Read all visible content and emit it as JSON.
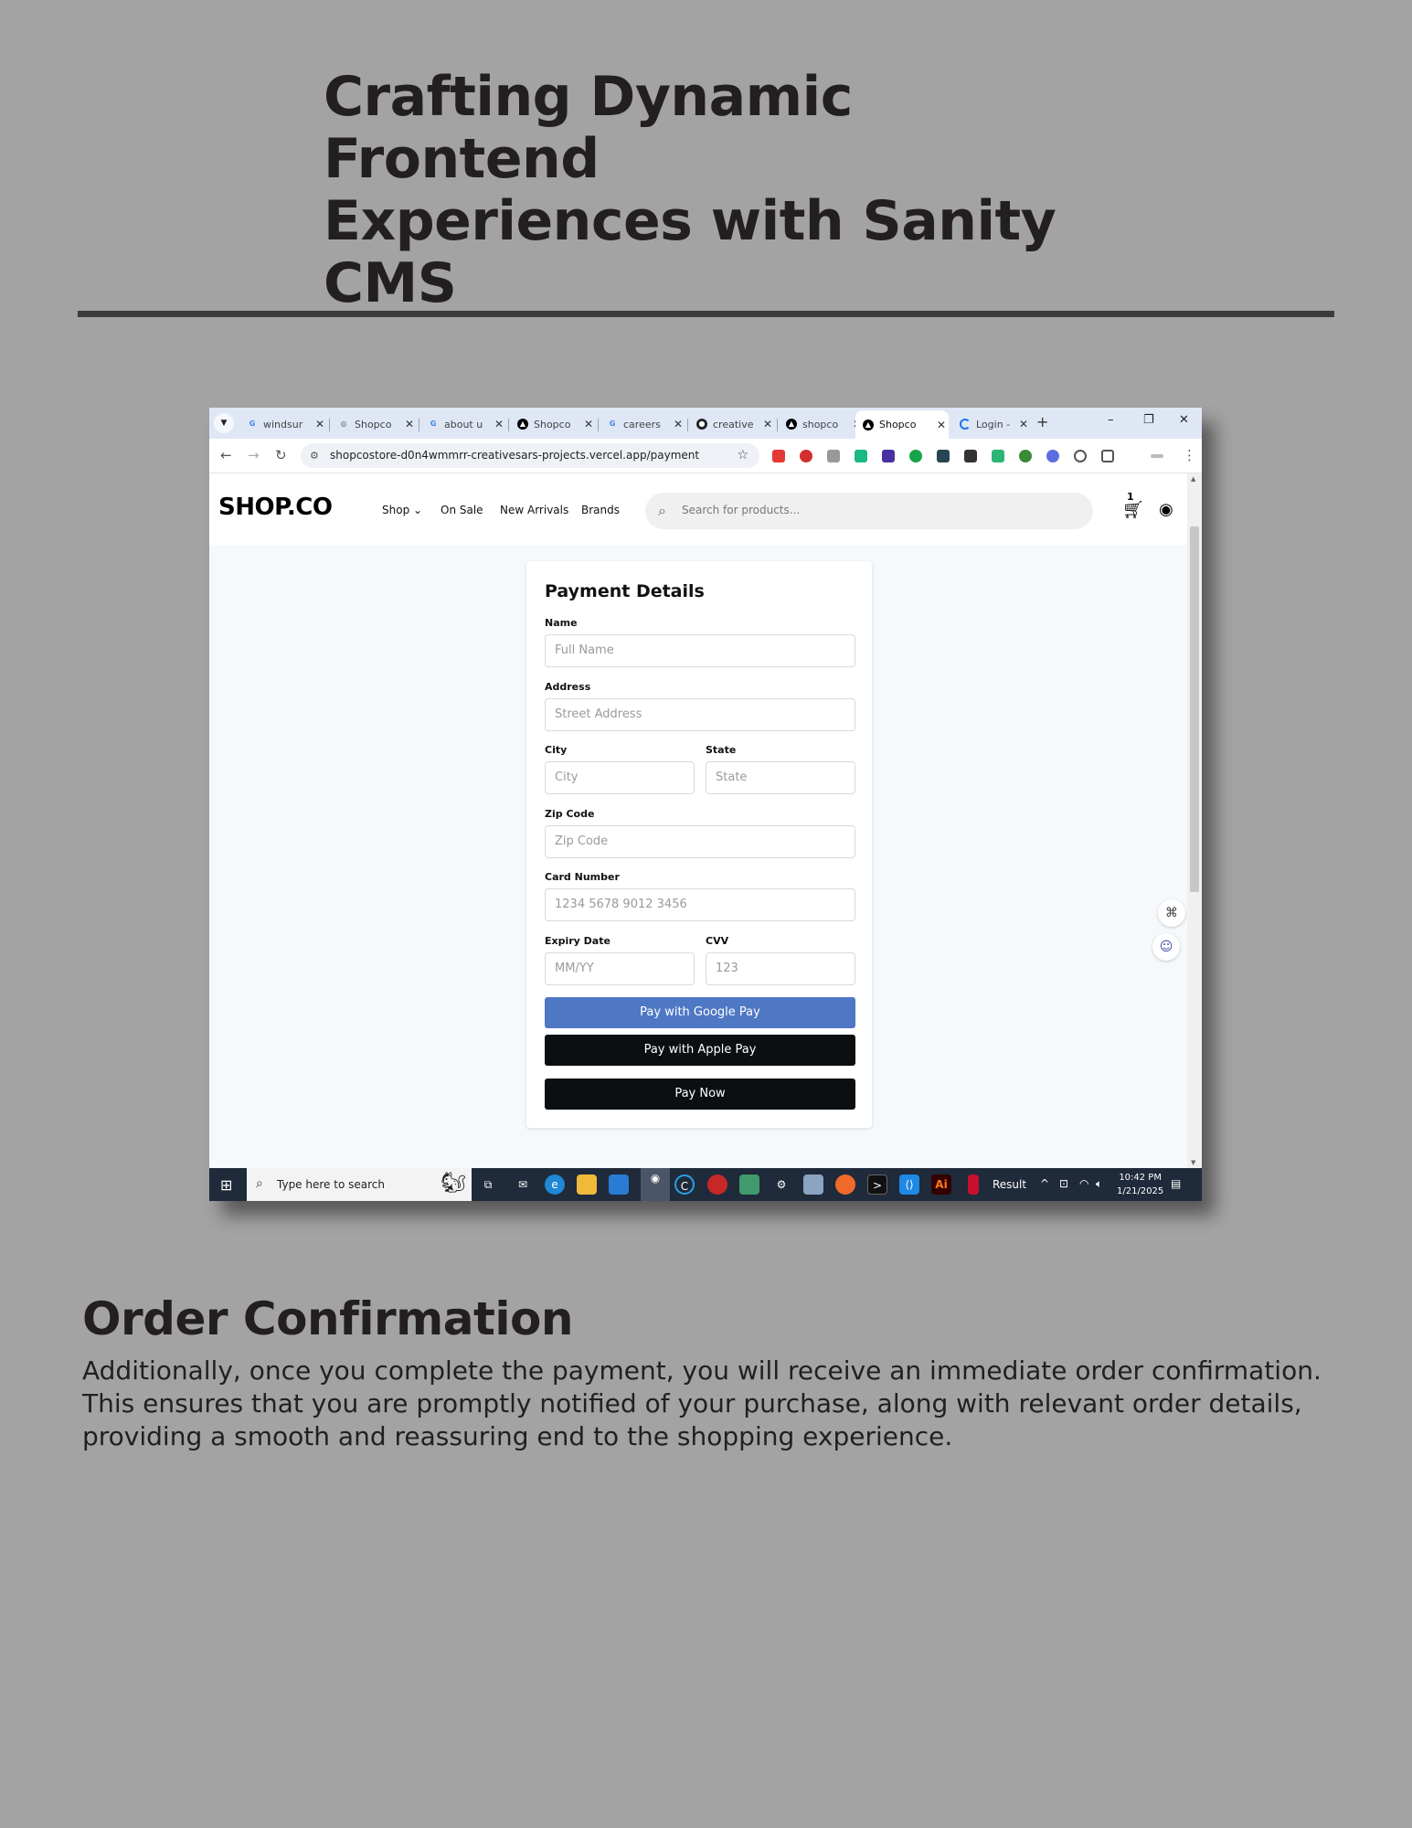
{
  "document": {
    "title_line1": "Crafting Dynamic Frontend",
    "title_line2": "Experiences with Sanity CMS",
    "section_title": "Order Confirmation",
    "section_body": "Additionally, once you complete the payment, you will receive an immediate order confirmation. This ensures that you are promptly notified of your purchase, along with relevant order details, providing a smooth and reassuring end to the shopping experience."
  },
  "browser": {
    "tabs": [
      {
        "label": "windsur",
        "icon": "google-icon"
      },
      {
        "label": "Shopco",
        "icon": "globe-icon"
      },
      {
        "label": "about u",
        "icon": "google-icon"
      },
      {
        "label": "Shopco",
        "icon": "vercel-icon"
      },
      {
        "label": "careers",
        "icon": "google-icon"
      },
      {
        "label": "creative",
        "icon": "github-icon"
      },
      {
        "label": "shopco",
        "icon": "vercel-icon"
      },
      {
        "label": "Shopco",
        "icon": "vercel-icon",
        "active": true
      },
      {
        "label": "Login -",
        "icon": "loading-icon"
      }
    ],
    "url": "shopcostore-d0n4wmmrr-creativesars-projects.vercel.app/payment"
  },
  "site": {
    "logo": "SHOP.CO",
    "nav": {
      "shop": "Shop",
      "on_sale": "On Sale",
      "new_arrivals": "New Arrivals",
      "brands": "Brands"
    },
    "search_placeholder": "Search for products...",
    "cart_count": "1"
  },
  "payment_form": {
    "heading": "Payment Details",
    "name_label": "Name",
    "name_placeholder": "Full Name",
    "address_label": "Address",
    "address_placeholder": "Street Address",
    "city_label": "City",
    "city_placeholder": "City",
    "state_label": "State",
    "state_placeholder": "State",
    "zip_label": "Zip Code",
    "zip_placeholder": "Zip Code",
    "card_label": "Card Number",
    "card_placeholder": "1234 5678 9012 3456",
    "expiry_label": "Expiry Date",
    "expiry_placeholder": "MM/YY",
    "cvv_label": "CVV",
    "cvv_placeholder": "123",
    "google_pay": "Pay with Google Pay",
    "apple_pay": "Pay with Apple Pay",
    "pay_now": "Pay Now"
  },
  "taskbar": {
    "search_text": "Type here to search",
    "result_label": "Result",
    "time": "10:42 PM",
    "date": "1/21/2025"
  },
  "colors": {
    "page_bg": "#a3a3a3",
    "google_pay": "#4f78c4",
    "dark_button": "#0b0f12",
    "taskbar": "#1f2a3a"
  }
}
